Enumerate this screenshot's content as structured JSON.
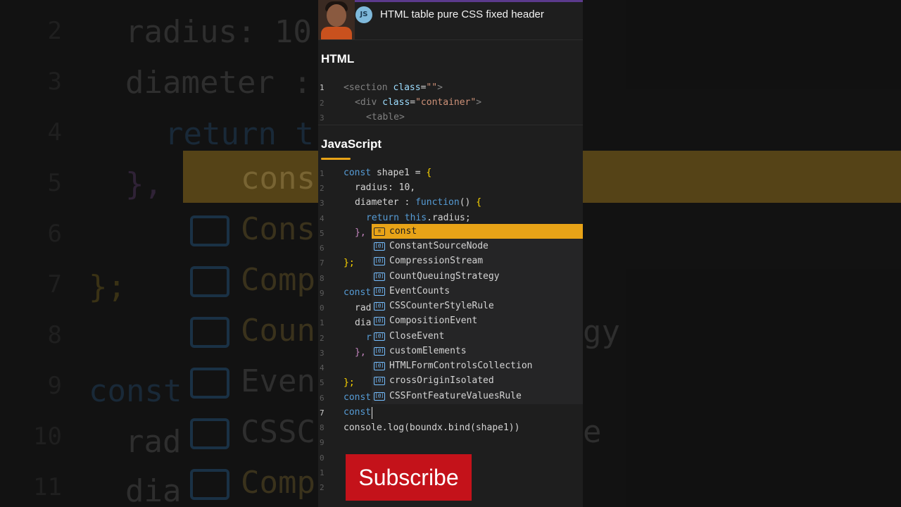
{
  "video": {
    "title": "HTML table pure CSS fixed header",
    "channel_badge": "JS"
  },
  "html_section": {
    "title": "HTML",
    "lines": [
      {
        "num": "1",
        "tag_open": "<section ",
        "attr": "class",
        "eq": "=",
        "value": "\"\"",
        "tag_close": ">"
      },
      {
        "num": "2",
        "tag_open": "<div ",
        "attr": "class",
        "eq": "=",
        "value": "\"container\"",
        "tag_close": ">"
      },
      {
        "num": "3",
        "tag_open": "<table",
        "attr": "",
        "eq": "",
        "value": "",
        "tag_close": ">"
      }
    ]
  },
  "js_section": {
    "title": "JavaScript",
    "gutter": [
      "1",
      "2",
      "3",
      "4",
      "5",
      "6",
      "7",
      "8",
      "9",
      "0",
      "1",
      "2",
      "3",
      "4",
      "5",
      "6",
      "7",
      "8",
      "9",
      "0",
      "1",
      "2"
    ],
    "lines": {
      "l1_kw": "const",
      "l1_rest": " shape1 = ",
      "l1_brace": "{",
      "l2": "radius: 10,",
      "l3_prop": "diameter : ",
      "l3_kw": "function",
      "l3_paren": "() ",
      "l3_brace": "{",
      "l4_kw": "return this",
      "l4_rest": ".radius;",
      "l5": "},",
      "l7": "};",
      "l8_kw": "const",
      "l9": "rad",
      "l10": "dia",
      "l11": "r",
      "l12": "},",
      "l14": "};",
      "l15_kw": "const",
      "l16_kw": "const",
      "l17": "console.log(boundx.bind(shape1))"
    }
  },
  "autocomplete": {
    "icon_glyph": "[@]",
    "items": [
      "const",
      "ConstantSourceNode",
      "CompressionStream",
      "CountQueuingStrategy",
      "EventCounts",
      "CSSCounterStyleRule",
      "CompositionEvent",
      "CloseEvent",
      "customElements",
      "HTMLFormControlsCollection",
      "crossOriginIsolated",
      "CSSFontFeatureValuesRule"
    ],
    "selected_index": 0
  },
  "subscribe_label": "Subscribe",
  "background": {
    "lines": [
      "radius: 10",
      "diameter :",
      "return t",
      "},",
      "cons",
      "Cons",
      "Comp",
      "};",
      "Coun",
      "const",
      "Even",
      "CSSC",
      "rad",
      "dia",
      "Comp",
      "gy",
      "e"
    ],
    "gutter": [
      "2",
      "3",
      "4",
      "5",
      "6",
      "7",
      "8",
      "9",
      "10",
      "11"
    ]
  },
  "colors": {
    "accent": "#e8a317",
    "subscribe": "#c4121a",
    "keyword": "#569cd6"
  }
}
